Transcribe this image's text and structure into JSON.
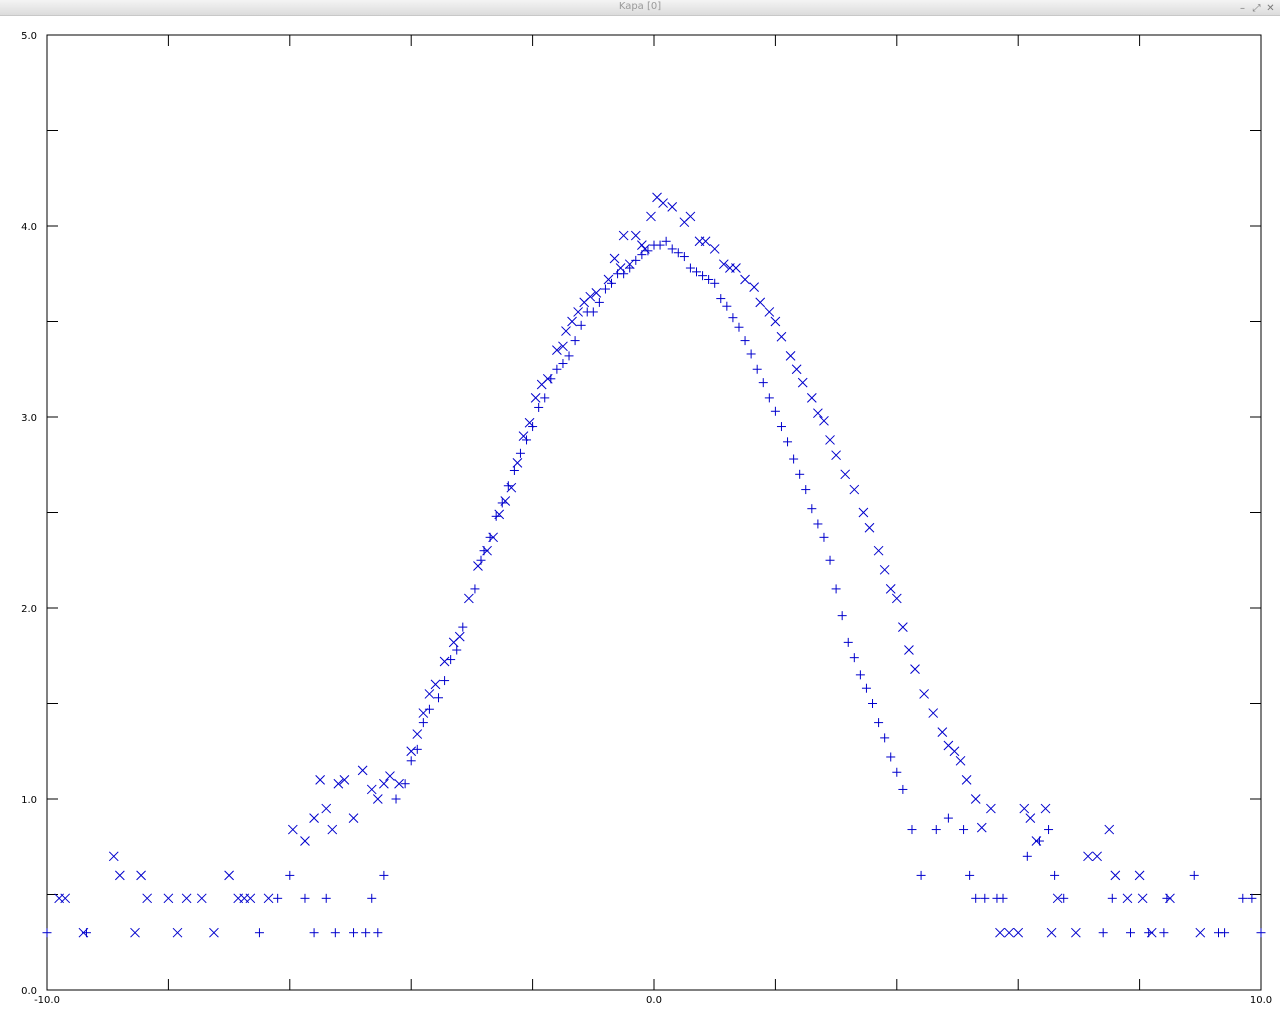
{
  "window": {
    "title": "Kapa [0]",
    "controls": {
      "minimize_icon": "minimize-icon",
      "maximize_icon": "maximize-icon",
      "close_icon": "close-icon"
    }
  },
  "chart_data": {
    "type": "scatter",
    "title": "",
    "xlabel": "",
    "ylabel": "",
    "xlim": [
      -10.0,
      10.0
    ],
    "ylim": [
      0.0,
      5.0
    ],
    "x_ticks": [
      -10.0,
      -8.0,
      -6.0,
      -4.0,
      -2.0,
      0.0,
      2.0,
      4.0,
      6.0,
      8.0,
      10.0
    ],
    "y_ticks": [
      0.0,
      0.5,
      1.0,
      1.5,
      2.0,
      2.5,
      3.0,
      3.5,
      4.0,
      4.5,
      5.0
    ],
    "x_tick_labels": [
      {
        "value": -10.0,
        "text": "-10.0"
      },
      {
        "value": 0.0,
        "text": "0.0"
      },
      {
        "value": 10.0,
        "text": "10.0"
      }
    ],
    "y_tick_labels": [
      {
        "value": 0.0,
        "text": "0.0"
      },
      {
        "value": 1.0,
        "text": "1.0"
      },
      {
        "value": 2.0,
        "text": "2.0"
      },
      {
        "value": 3.0,
        "text": "3.0"
      },
      {
        "value": 4.0,
        "text": "4.0"
      },
      {
        "value": 5.0,
        "text": "5.0"
      }
    ],
    "grid": false,
    "marker_color": "#0000cc",
    "axis_color": "#000000",
    "series": [
      {
        "marker": "plus",
        "points": [
          [
            -10.0,
            0.3
          ],
          [
            -9.35,
            0.3
          ],
          [
            -6.5,
            0.3
          ],
          [
            -6.2,
            0.48
          ],
          [
            -6.0,
            0.6
          ],
          [
            -5.75,
            0.48
          ],
          [
            -5.6,
            0.3
          ],
          [
            -5.4,
            0.48
          ],
          [
            -5.25,
            0.3
          ],
          [
            -4.95,
            0.3
          ],
          [
            -4.75,
            0.3
          ],
          [
            -4.65,
            0.48
          ],
          [
            -4.55,
            0.3
          ],
          [
            -4.45,
            0.6
          ],
          [
            -4.25,
            1.0
          ],
          [
            -4.1,
            1.08
          ],
          [
            -4.0,
            1.2
          ],
          [
            -3.9,
            1.26
          ],
          [
            -3.8,
            1.4
          ],
          [
            -3.7,
            1.47
          ],
          [
            -3.55,
            1.53
          ],
          [
            -3.45,
            1.62
          ],
          [
            -3.35,
            1.73
          ],
          [
            -3.25,
            1.78
          ],
          [
            -3.15,
            1.9
          ],
          [
            -2.95,
            2.1
          ],
          [
            -2.85,
            2.25
          ],
          [
            -2.8,
            2.3
          ],
          [
            -2.7,
            2.37
          ],
          [
            -2.6,
            2.48
          ],
          [
            -2.5,
            2.55
          ],
          [
            -2.4,
            2.64
          ],
          [
            -2.3,
            2.72
          ],
          [
            -2.2,
            2.81
          ],
          [
            -2.1,
            2.88
          ],
          [
            -2.0,
            2.95
          ],
          [
            -1.9,
            3.05
          ],
          [
            -1.8,
            3.1
          ],
          [
            -1.7,
            3.2
          ],
          [
            -1.6,
            3.25
          ],
          [
            -1.5,
            3.28
          ],
          [
            -1.4,
            3.32
          ],
          [
            -1.3,
            3.4
          ],
          [
            -1.2,
            3.48
          ],
          [
            -1.1,
            3.55
          ],
          [
            -1.0,
            3.55
          ],
          [
            -0.9,
            3.6
          ],
          [
            -0.8,
            3.67
          ],
          [
            -0.7,
            3.7
          ],
          [
            -0.6,
            3.75
          ],
          [
            -0.5,
            3.75
          ],
          [
            -0.4,
            3.78
          ],
          [
            -0.3,
            3.82
          ],
          [
            -0.2,
            3.85
          ],
          [
            -0.1,
            3.87
          ],
          [
            0.0,
            3.9
          ],
          [
            0.1,
            3.9
          ],
          [
            0.2,
            3.92
          ],
          [
            0.3,
            3.88
          ],
          [
            0.4,
            3.86
          ],
          [
            0.5,
            3.84
          ],
          [
            0.6,
            3.78
          ],
          [
            0.7,
            3.76
          ],
          [
            0.8,
            3.74
          ],
          [
            0.9,
            3.72
          ],
          [
            1.0,
            3.7
          ],
          [
            1.1,
            3.62
          ],
          [
            1.2,
            3.58
          ],
          [
            1.3,
            3.52
          ],
          [
            1.4,
            3.47
          ],
          [
            1.5,
            3.4
          ],
          [
            1.6,
            3.33
          ],
          [
            1.7,
            3.25
          ],
          [
            1.8,
            3.18
          ],
          [
            1.9,
            3.1
          ],
          [
            2.0,
            3.03
          ],
          [
            2.1,
            2.95
          ],
          [
            2.2,
            2.87
          ],
          [
            2.3,
            2.78
          ],
          [
            2.4,
            2.7
          ],
          [
            2.5,
            2.62
          ],
          [
            2.6,
            2.52
          ],
          [
            2.7,
            2.44
          ],
          [
            2.8,
            2.37
          ],
          [
            2.9,
            2.25
          ],
          [
            3.0,
            2.1
          ],
          [
            3.1,
            1.96
          ],
          [
            3.2,
            1.82
          ],
          [
            3.3,
            1.74
          ],
          [
            3.4,
            1.65
          ],
          [
            3.5,
            1.58
          ],
          [
            3.6,
            1.5
          ],
          [
            3.7,
            1.4
          ],
          [
            3.8,
            1.32
          ],
          [
            3.9,
            1.22
          ],
          [
            4.0,
            1.14
          ],
          [
            4.1,
            1.05
          ],
          [
            4.25,
            0.84
          ],
          [
            4.4,
            0.6
          ],
          [
            4.65,
            0.84
          ],
          [
            4.85,
            0.9
          ],
          [
            5.1,
            0.84
          ],
          [
            5.2,
            0.6
          ],
          [
            5.3,
            0.48
          ],
          [
            5.45,
            0.48
          ],
          [
            5.65,
            0.48
          ],
          [
            5.75,
            0.48
          ],
          [
            6.15,
            0.7
          ],
          [
            6.35,
            0.78
          ],
          [
            6.5,
            0.84
          ],
          [
            6.6,
            0.6
          ],
          [
            6.75,
            0.48
          ],
          [
            7.4,
            0.3
          ],
          [
            7.55,
            0.48
          ],
          [
            7.85,
            0.3
          ],
          [
            8.15,
            0.3
          ],
          [
            8.4,
            0.3
          ],
          [
            8.45,
            0.48
          ],
          [
            8.9,
            0.6
          ],
          [
            9.3,
            0.3
          ],
          [
            9.4,
            0.3
          ],
          [
            9.7,
            0.48
          ],
          [
            9.85,
            0.48
          ],
          [
            10.0,
            0.3
          ]
        ]
      },
      {
        "marker": "cross",
        "points": [
          [
            -9.8,
            0.48
          ],
          [
            -9.7,
            0.48
          ],
          [
            -9.4,
            0.3
          ],
          [
            -8.9,
            0.7
          ],
          [
            -8.8,
            0.6
          ],
          [
            -8.55,
            0.3
          ],
          [
            -8.45,
            0.6
          ],
          [
            -8.35,
            0.48
          ],
          [
            -8.0,
            0.48
          ],
          [
            -7.85,
            0.3
          ],
          [
            -7.7,
            0.48
          ],
          [
            -7.45,
            0.48
          ],
          [
            -7.25,
            0.3
          ],
          [
            -7.0,
            0.6
          ],
          [
            -6.85,
            0.48
          ],
          [
            -6.75,
            0.48
          ],
          [
            -6.65,
            0.48
          ],
          [
            -6.35,
            0.48
          ],
          [
            -5.95,
            0.84
          ],
          [
            -5.75,
            0.78
          ],
          [
            -5.6,
            0.9
          ],
          [
            -5.5,
            1.1
          ],
          [
            -5.4,
            0.95
          ],
          [
            -5.3,
            0.84
          ],
          [
            -5.2,
            1.08
          ],
          [
            -5.1,
            1.1
          ],
          [
            -4.95,
            0.9
          ],
          [
            -4.8,
            1.15
          ],
          [
            -4.65,
            1.05
          ],
          [
            -4.55,
            1.0
          ],
          [
            -4.45,
            1.08
          ],
          [
            -4.35,
            1.12
          ],
          [
            -4.2,
            1.08
          ],
          [
            -4.0,
            1.25
          ],
          [
            -3.9,
            1.34
          ],
          [
            -3.8,
            1.45
          ],
          [
            -3.7,
            1.55
          ],
          [
            -3.6,
            1.6
          ],
          [
            -3.45,
            1.72
          ],
          [
            -3.3,
            1.82
          ],
          [
            -3.2,
            1.85
          ],
          [
            -3.05,
            2.05
          ],
          [
            -2.9,
            2.22
          ],
          [
            -2.75,
            2.3
          ],
          [
            -2.65,
            2.37
          ],
          [
            -2.55,
            2.49
          ],
          [
            -2.45,
            2.56
          ],
          [
            -2.35,
            2.63
          ],
          [
            -2.25,
            2.76
          ],
          [
            -2.15,
            2.9
          ],
          [
            -2.05,
            2.97
          ],
          [
            -1.95,
            3.1
          ],
          [
            -1.85,
            3.17
          ],
          [
            -1.75,
            3.2
          ],
          [
            -1.6,
            3.35
          ],
          [
            -1.5,
            3.37
          ],
          [
            -1.45,
            3.45
          ],
          [
            -1.35,
            3.5
          ],
          [
            -1.25,
            3.55
          ],
          [
            -1.15,
            3.6
          ],
          [
            -1.05,
            3.63
          ],
          [
            -0.95,
            3.65
          ],
          [
            -0.75,
            3.72
          ],
          [
            -0.65,
            3.83
          ],
          [
            -0.55,
            3.78
          ],
          [
            -0.5,
            3.95
          ],
          [
            -0.4,
            3.8
          ],
          [
            -0.3,
            3.95
          ],
          [
            -0.2,
            3.9
          ],
          [
            -0.15,
            3.88
          ],
          [
            -0.05,
            4.05
          ],
          [
            0.05,
            4.15
          ],
          [
            0.15,
            4.12
          ],
          [
            0.3,
            4.1
          ],
          [
            0.5,
            4.02
          ],
          [
            0.6,
            4.05
          ],
          [
            0.75,
            3.92
          ],
          [
            0.85,
            3.92
          ],
          [
            1.0,
            3.88
          ],
          [
            1.15,
            3.8
          ],
          [
            1.25,
            3.78
          ],
          [
            1.35,
            3.78
          ],
          [
            1.5,
            3.72
          ],
          [
            1.65,
            3.68
          ],
          [
            1.75,
            3.6
          ],
          [
            1.9,
            3.55
          ],
          [
            2.0,
            3.5
          ],
          [
            2.1,
            3.42
          ],
          [
            2.25,
            3.32
          ],
          [
            2.35,
            3.25
          ],
          [
            2.45,
            3.18
          ],
          [
            2.6,
            3.1
          ],
          [
            2.7,
            3.02
          ],
          [
            2.8,
            2.98
          ],
          [
            2.9,
            2.88
          ],
          [
            3.0,
            2.8
          ],
          [
            3.15,
            2.7
          ],
          [
            3.3,
            2.62
          ],
          [
            3.45,
            2.5
          ],
          [
            3.55,
            2.42
          ],
          [
            3.7,
            2.3
          ],
          [
            3.8,
            2.2
          ],
          [
            3.9,
            2.1
          ],
          [
            4.0,
            2.05
          ],
          [
            4.1,
            1.9
          ],
          [
            4.2,
            1.78
          ],
          [
            4.3,
            1.68
          ],
          [
            4.45,
            1.55
          ],
          [
            4.6,
            1.45
          ],
          [
            4.75,
            1.35
          ],
          [
            4.85,
            1.28
          ],
          [
            4.95,
            1.25
          ],
          [
            5.05,
            1.2
          ],
          [
            5.15,
            1.1
          ],
          [
            5.3,
            1.0
          ],
          [
            5.4,
            0.85
          ],
          [
            5.55,
            0.95
          ],
          [
            5.7,
            0.3
          ],
          [
            5.85,
            0.3
          ],
          [
            6.0,
            0.3
          ],
          [
            6.1,
            0.95
          ],
          [
            6.2,
            0.9
          ],
          [
            6.3,
            0.78
          ],
          [
            6.45,
            0.95
          ],
          [
            6.55,
            0.3
          ],
          [
            6.65,
            0.48
          ],
          [
            6.95,
            0.3
          ],
          [
            7.15,
            0.7
          ],
          [
            7.3,
            0.7
          ],
          [
            7.5,
            0.84
          ],
          [
            7.6,
            0.6
          ],
          [
            7.8,
            0.48
          ],
          [
            8.0,
            0.6
          ],
          [
            8.05,
            0.48
          ],
          [
            8.2,
            0.3
          ],
          [
            8.5,
            0.48
          ],
          [
            9.0,
            0.3
          ]
        ]
      }
    ]
  }
}
